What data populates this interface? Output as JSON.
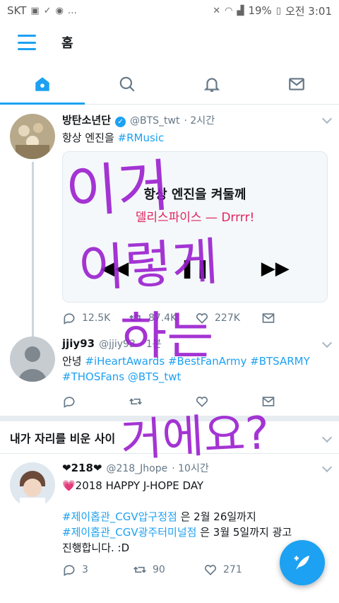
{
  "status": {
    "carrier": "SKT",
    "battery": "19%",
    "time": "오전 3:01"
  },
  "header": {
    "title": "홈"
  },
  "tabs": [
    {
      "icon": "home-icon"
    },
    {
      "icon": "search-icon"
    },
    {
      "icon": "bell-icon"
    },
    {
      "icon": "mail-icon"
    }
  ],
  "tweets": {
    "t1": {
      "name": "방탄소년단",
      "handle": "@BTS_twt",
      "time": "· 2시간",
      "text_plain": "항상 엔진을 ",
      "text_link": "#RMusic",
      "card_line1": "항상 엔진을 켜둘께",
      "card_line2": "델리스파이스 — Drrrr!",
      "replies": "12.5K",
      "retweets": "87.4K",
      "likes": "227K"
    },
    "t2": {
      "name": "jjiy93",
      "handle": "@jjiy93",
      "time": "· 1분",
      "text_plain": "안녕 ",
      "text_link": "#iHeartAwards #BestFanArmy #BTSARMY #THOSFans @BTS_twt"
    },
    "section": {
      "title": "내가 자리를 비운 사이"
    },
    "t3": {
      "name": "❤218❤",
      "handle": "@218_Jhope",
      "time": "· 10시간",
      "line1": "💗2018 HAPPY J-HOPE DAY",
      "link1": "#제이홉관_CGV압구정점",
      "after1": " 은 2월 26일까지",
      "link2": "#제이홉관_CGV광주터미널점",
      "after2": " 은 3월 5일까지 광고",
      "line4": "진행합니다. :D",
      "replies": "3",
      "retweets": "90",
      "likes": "271"
    }
  },
  "overlay": {
    "line1": "이거",
    "line2": "이렇게",
    "line3": "하는",
    "line4": "거에요?"
  },
  "colors": {
    "accent": "#1da1f2",
    "scribble": "#9b1fcf"
  }
}
